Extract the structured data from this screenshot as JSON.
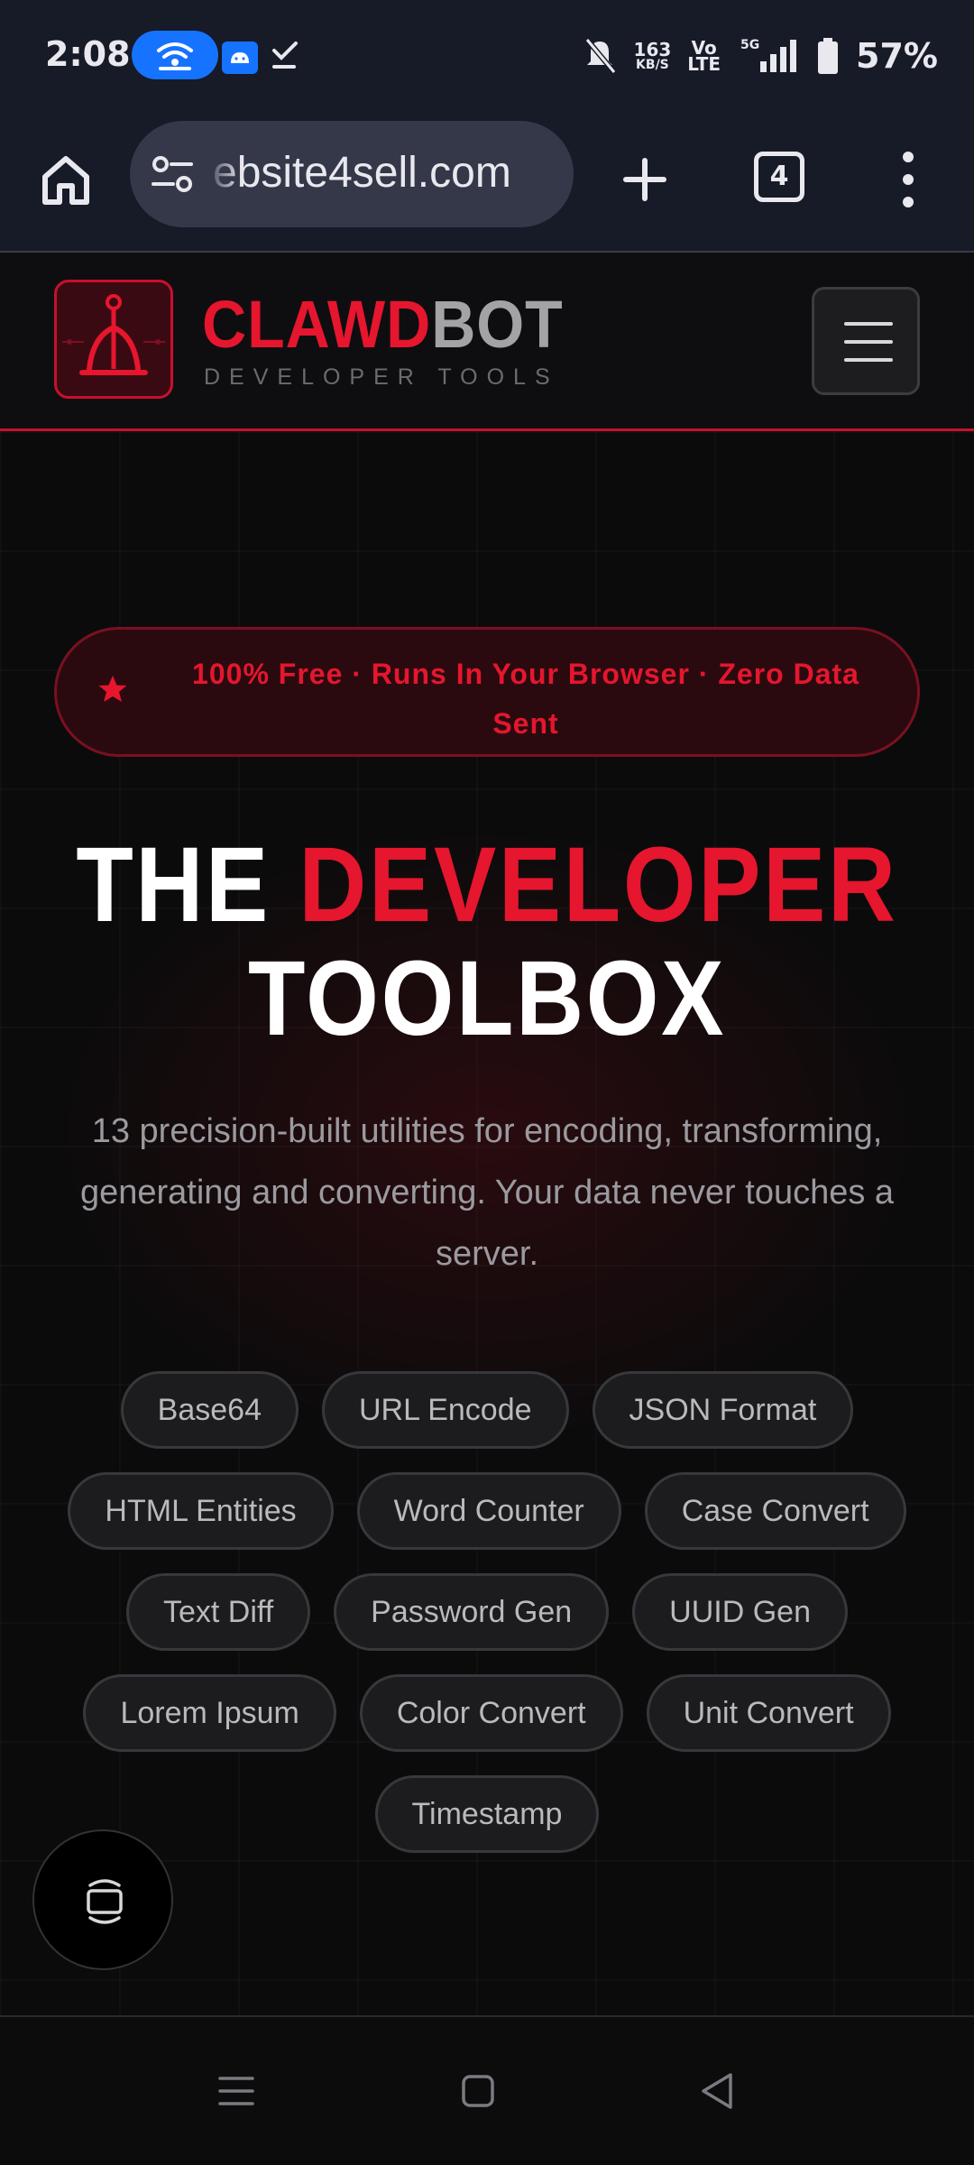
{
  "status_bar": {
    "time": "2:08",
    "net_speed_value": "163",
    "net_speed_unit": "KB/S",
    "volte_top": "Vo",
    "volte_bottom": "LTE",
    "network": "5G",
    "battery": "57%",
    "icons": [
      "hotspot-icon",
      "android-icon",
      "check-icon",
      "mute-icon",
      "signal-icon",
      "battery-icon"
    ]
  },
  "browser": {
    "url": "ebsite4sell.com",
    "tab_count": "4",
    "icons": [
      "home-icon",
      "site-settings-icon",
      "plus-icon",
      "tabs-icon",
      "more-vert-icon"
    ]
  },
  "header": {
    "brand_red": "CLAWD",
    "brand_grey": "BOT",
    "tagline": "DEVELOPER TOOLS",
    "accent": "#e5162e"
  },
  "hero": {
    "badge": "100% Free · Runs In Your Browser · Zero Data Sent",
    "title_white_1": "THE",
    "title_red": "DEVELOPER",
    "title_white_2": "TOOLBOX",
    "subtitle": "13 precision-built utilities for encoding, transforming, generating and converting. Your data never touches a server.",
    "tools": [
      "Base64",
      "URL Encode",
      "JSON Format",
      "HTML Entities",
      "Word Counter",
      "Case Convert",
      "Text Diff",
      "Password Gen",
      "UUID Gen",
      "Lorem Ipsum",
      "Color Convert",
      "Unit Convert",
      "Timestamp"
    ]
  },
  "nav": {
    "icons": [
      "recents-icon",
      "home-square-icon",
      "back-icon"
    ]
  }
}
